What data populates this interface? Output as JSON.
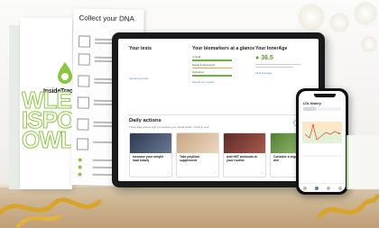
{
  "kit": {
    "brand": "InsideTracker",
    "side_words": [
      "WLED",
      "ISPOW",
      "OWLE"
    ],
    "accent_color": "#8cc63f"
  },
  "sheet": {
    "title": "Collect your DNA"
  },
  "tablet": {
    "tests": {
      "title": "Your tests",
      "link": "See all your tests"
    },
    "biomarkers": {
      "title": "Your biomarkers at a glance",
      "rows": [
        {
          "label": "In Goal",
          "color": "#6cb33e"
        },
        {
          "label": "Needs improvement",
          "color": "#f2a33a"
        },
        {
          "label": "Optimized",
          "color": "#6cb33e"
        }
      ],
      "link": "See all your results"
    },
    "innerage": {
      "title": "Your InnerAge",
      "value": "36.5",
      "link": "View InnerAge"
    },
    "daily": {
      "title": "Daily actions",
      "subtitle": "These daily actions help you improve your overall health. Check in now!",
      "button": "Options"
    },
    "cards": [
      {
        "text": "Increase your weight load slowly",
        "color": "#3c4a66"
      },
      {
        "text": "Take psyllium supplement",
        "color": "#d4b598"
      },
      {
        "text": "Add HIIT workouts to your routine",
        "color": "#7a3a36"
      },
      {
        "text": "Consider a vegetarian diet",
        "color": "#6b9a4a"
      }
    ]
  },
  "phone": {
    "title": "LDL history"
  }
}
